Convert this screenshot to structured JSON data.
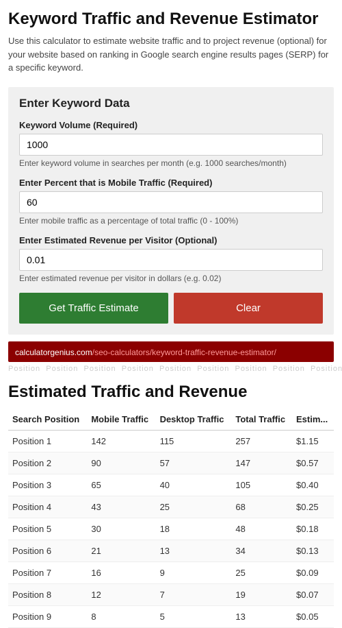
{
  "header": {
    "title": "Keyword Traffic and Revenue Estimator",
    "description": "Use this calculator to estimate website traffic and to project revenue (optional) for your website based on ranking in Google search engine results pages (SERP) for a specific keyword."
  },
  "form": {
    "section_title": "Enter Keyword Data",
    "fields": [
      {
        "id": "keyword_volume",
        "label": "Keyword Volume (Required)",
        "value": "1000",
        "hint": "Enter keyword volume in searches per month (e.g. 1000 searches/month)",
        "placeholder": ""
      },
      {
        "id": "mobile_traffic",
        "label": "Enter Percent that is Mobile Traffic (Required)",
        "value": "60",
        "hint": "Enter mobile traffic as a percentage of total traffic (0 - 100%)",
        "placeholder": ""
      },
      {
        "id": "revenue_per_visitor",
        "label": "Enter Estimated Revenue per Visitor (Optional)",
        "value": "0.01",
        "hint": "Enter estimated revenue per visitor in dollars (e.g. 0.02)",
        "placeholder": ""
      }
    ],
    "btn_calculate": "Get Traffic Estimate",
    "btn_clear": "Clear"
  },
  "url_bar": {
    "base": "calculatorgenius.com",
    "path": "/seo-calculators/keyword-traffic-revenue-estimator/"
  },
  "results": {
    "title": "Estimated Traffic and Revenue",
    "columns": [
      "Search Position",
      "Mobile Traffic",
      "Desktop Traffic",
      "Total Traffic",
      "Estim..."
    ],
    "rows": [
      {
        "position": "Position 1",
        "mobile": "142",
        "desktop": "115",
        "total": "257",
        "revenue": "$1.15"
      },
      {
        "position": "Position 2",
        "mobile": "90",
        "desktop": "57",
        "total": "147",
        "revenue": "$0.57"
      },
      {
        "position": "Position 3",
        "mobile": "65",
        "desktop": "40",
        "total": "105",
        "revenue": "$0.40"
      },
      {
        "position": "Position 4",
        "mobile": "43",
        "desktop": "25",
        "total": "68",
        "revenue": "$0.25"
      },
      {
        "position": "Position 5",
        "mobile": "30",
        "desktop": "18",
        "total": "48",
        "revenue": "$0.18"
      },
      {
        "position": "Position 6",
        "mobile": "21",
        "desktop": "13",
        "total": "34",
        "revenue": "$0.13"
      },
      {
        "position": "Position 7",
        "mobile": "16",
        "desktop": "9",
        "total": "25",
        "revenue": "$0.09"
      },
      {
        "position": "Position 8",
        "mobile": "12",
        "desktop": "7",
        "total": "19",
        "revenue": "$0.07"
      },
      {
        "position": "Position 9",
        "mobile": "8",
        "desktop": "5",
        "total": "13",
        "revenue": "$0.05"
      }
    ]
  }
}
